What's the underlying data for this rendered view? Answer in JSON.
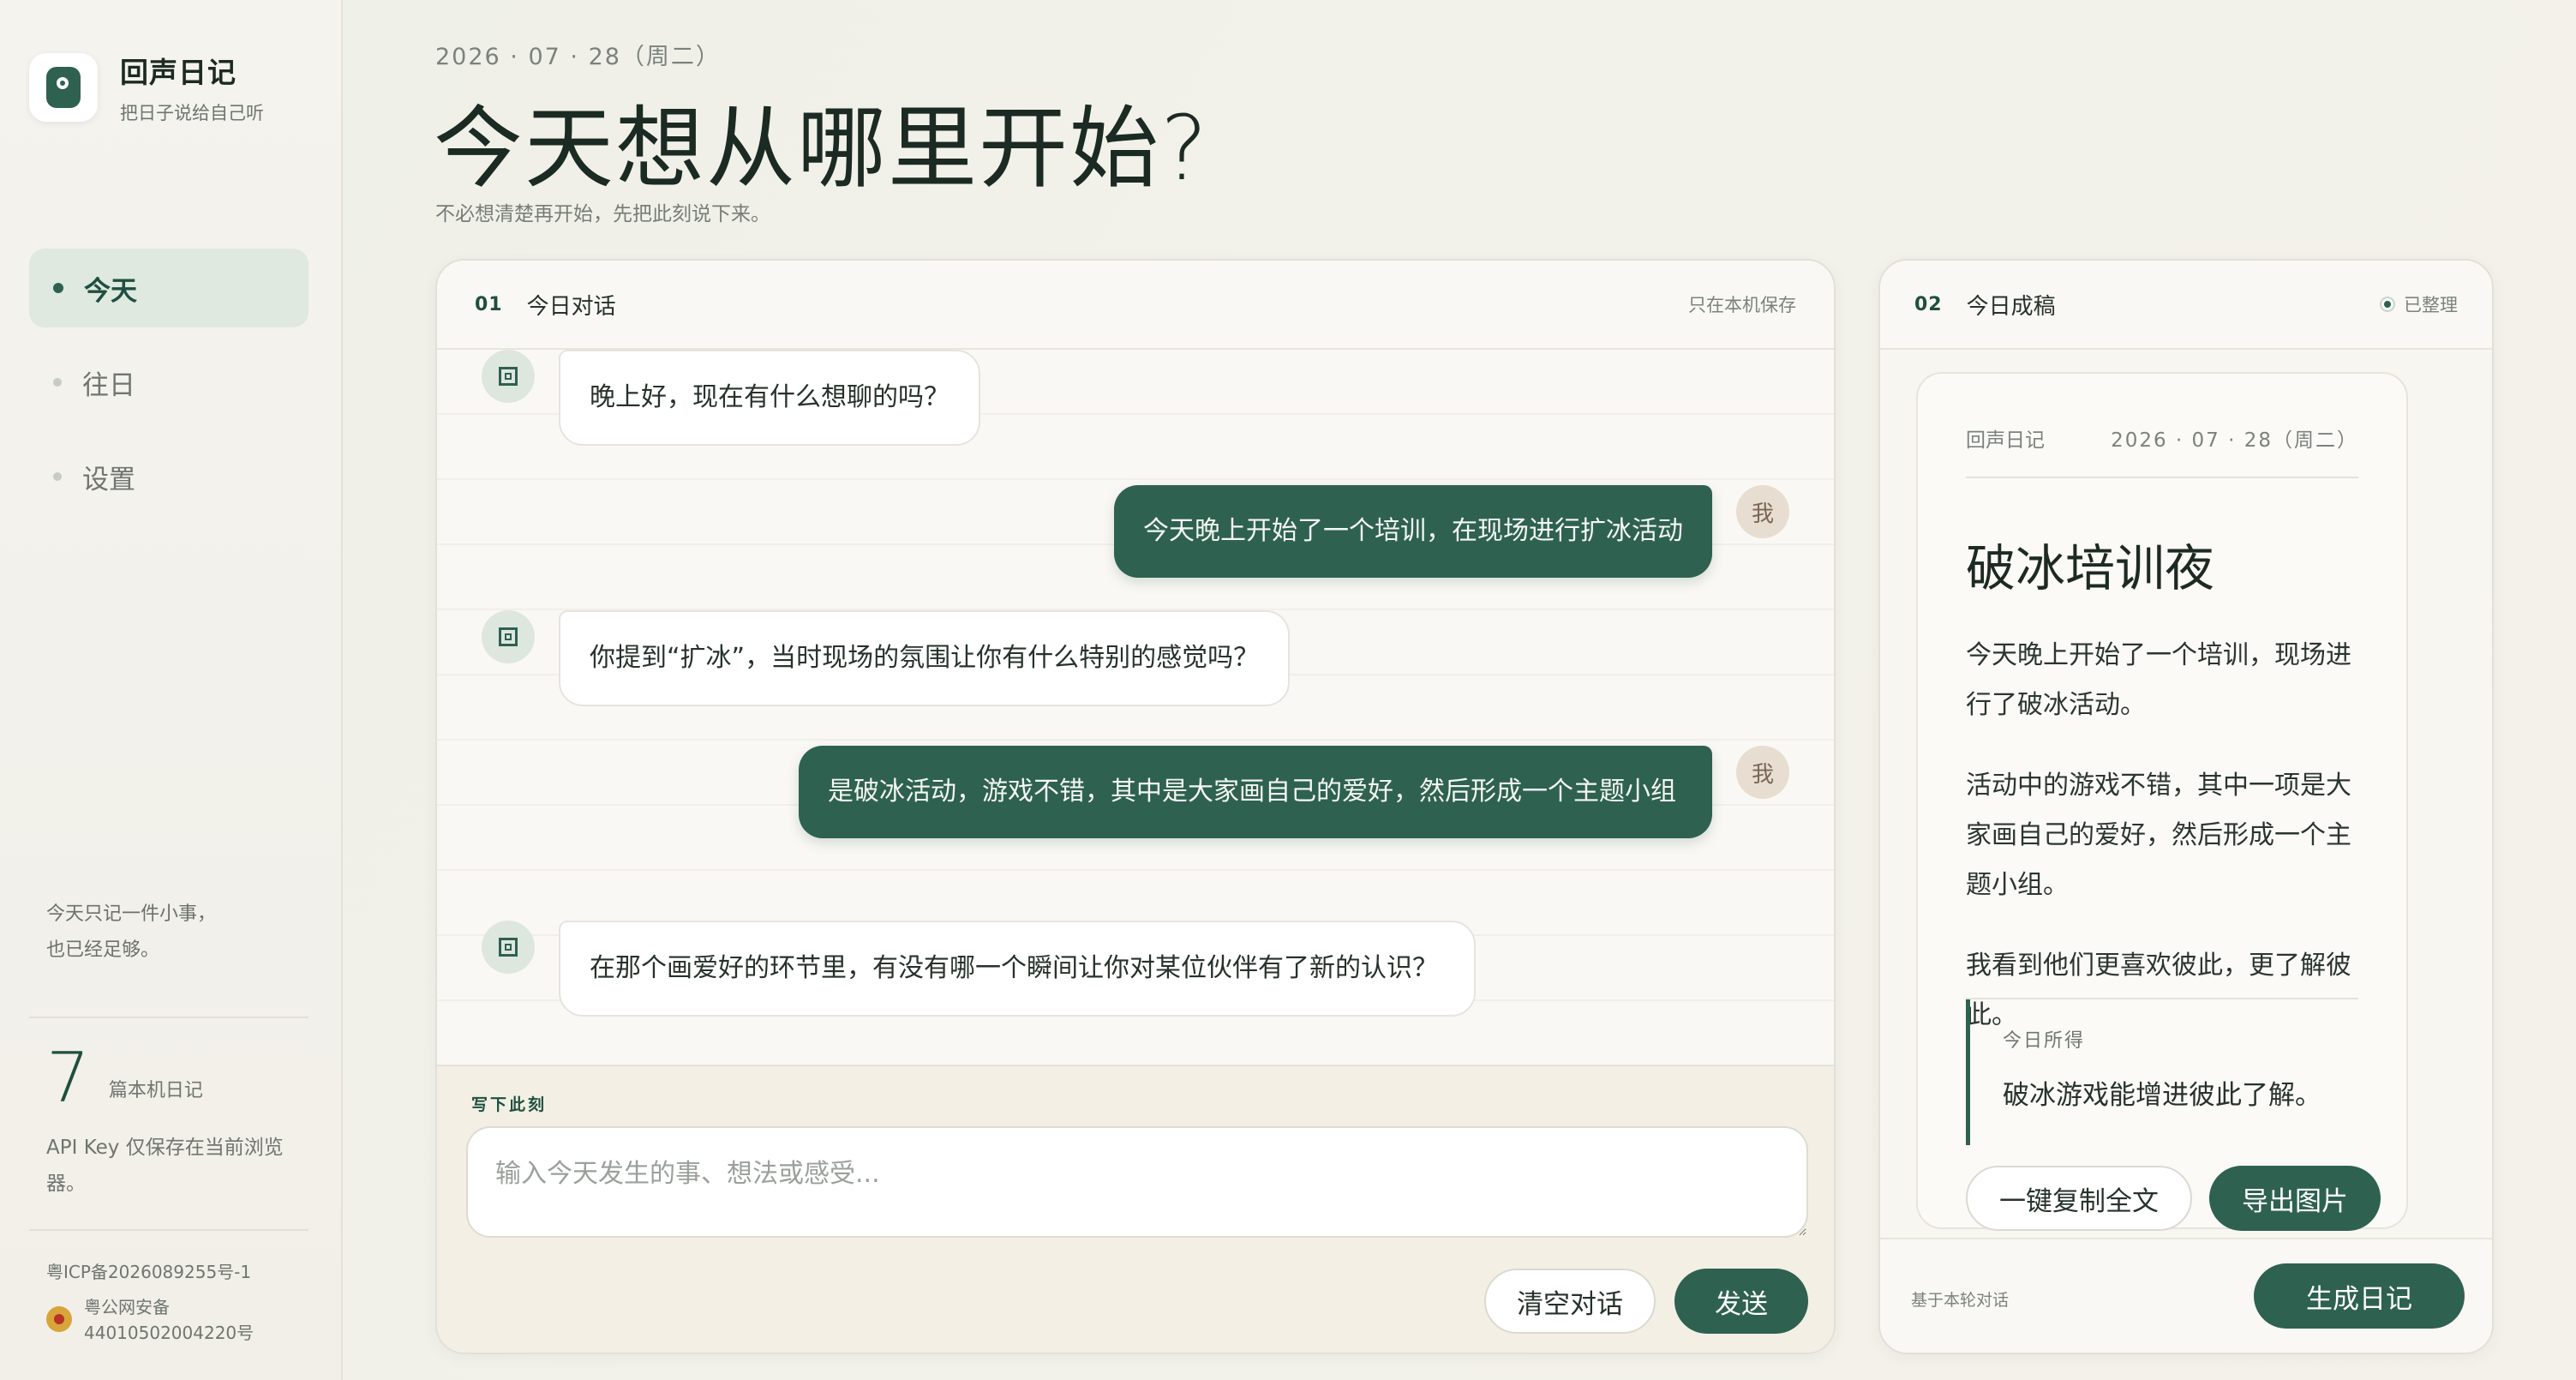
{
  "brand": {
    "name": "回声日记",
    "tagline": "把日子说给自己听"
  },
  "nav": [
    {
      "label": "今天",
      "active": true
    },
    {
      "label": "往日",
      "active": false
    },
    {
      "label": "设置",
      "active": false
    }
  ],
  "sidebar": {
    "quote_line1": "今天只记一件小事，",
    "quote_line2": "也已经足够。",
    "count": "7",
    "count_label": "篇本机日记",
    "api_note": "API Key 仅保存在当前浏览器。",
    "icp": "粤ICP备2026089255号-1",
    "police_line1": "粤公网安备",
    "police_line2": "44010502004220号"
  },
  "header": {
    "date": "2026 · 07 · 28（周二）",
    "title": "今天想从哪里开始?",
    "subtitle": "不必想清楚再开始，先把此刻说下来。"
  },
  "chat": {
    "num": "01",
    "title": "今日对话",
    "storage_note": "只在本机保存",
    "me_avatar": "我",
    "messages": [
      {
        "role": "bot",
        "text": "晚上好，现在有什么想聊的吗？"
      },
      {
        "role": "me",
        "text": "今天晚上开始了一个培训，在现场进行扩冰活动"
      },
      {
        "role": "bot",
        "text": "你提到“扩冰”，当时现场的氛围让你有什么特别的感觉吗？"
      },
      {
        "role": "me",
        "text": "是破冰活动，游戏不错，其中是大家画自己的爱好，然后形成一个主题小组"
      },
      {
        "role": "bot",
        "text": "在那个画爱好的环节里，有没有哪一个瞬间让你对某位伙伴有了新的认识？"
      }
    ],
    "compose_label": "写下此刻",
    "input_placeholder": "输入今天发生的事、想法或感受...",
    "clear_label": "清空对话",
    "send_label": "发送"
  },
  "diary": {
    "num": "02",
    "title": "今日成稿",
    "status": "已整理",
    "paper_brand": "回声日记",
    "paper_date": "2026 · 07 · 28（周二）",
    "entry_title": "破冰培训夜",
    "paragraphs": [
      "今天晚上开始了一个培训，现场进行了破冰活动。",
      "活动中的游戏不错，其中一项是大家画自己的爱好，然后形成一个主题小组。",
      "我看到他们更喜欢彼此，更了解彼此。"
    ],
    "gain_label": "今日所得",
    "gain_text": "破冰游戏能增进彼此了解。",
    "copy_label": "一键复制全文",
    "export_label": "导出图片",
    "footer_note": "基于本轮对话",
    "generate_label": "生成日记"
  },
  "colors": {
    "accent": "#2e6150",
    "accent_soft": "#dfe9e0",
    "background": "#f2f1ea"
  }
}
